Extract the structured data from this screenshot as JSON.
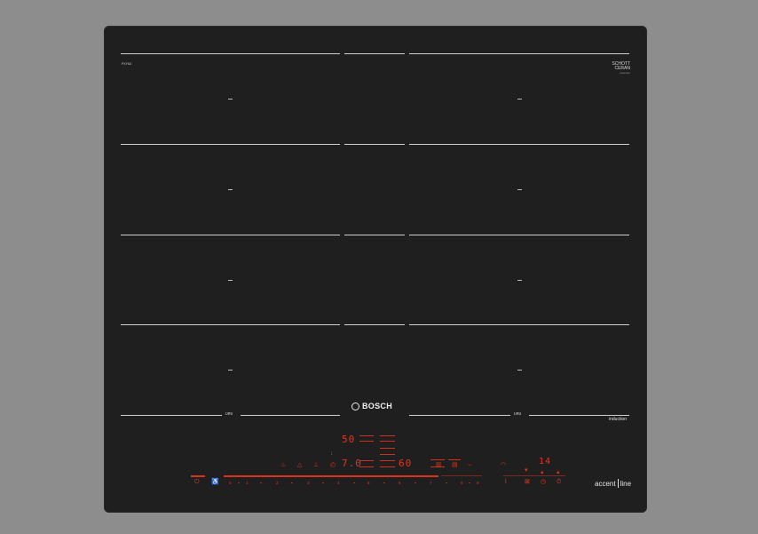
{
  "model_label": "PXY63",
  "brand": "BOSCH",
  "glass_brand": {
    "line1": "SCHOTT",
    "line2": "CERAN",
    "line3": "premium"
  },
  "induction_label": "induction",
  "series_label": {
    "part1": "accent",
    "part2": "line"
  },
  "zone_marker": "—",
  "flex_label": "ᴜᴙᴜ",
  "display": {
    "left_top": "50",
    "left_main": "7.0",
    "right_main": "60",
    "timer": "14"
  },
  "power_scale": [
    "0",
    "1",
    "2",
    "3",
    "4",
    "5",
    "6",
    "7",
    "8",
    "9"
  ],
  "icons": {
    "power": "power-icon",
    "childlock": "child-lock-icon",
    "pan": "pan-icon",
    "frying": "frying-sensor-icon",
    "flex": "flex-zone-icon",
    "timer": "timer-icon",
    "wifi": "wifi-icon",
    "clock": "clock-icon",
    "keepwarm": "keep-warm-icon"
  },
  "colors": {
    "glass": "#1f1f1f",
    "display": "#e8341a",
    "frame": "#8d8d8d"
  }
}
